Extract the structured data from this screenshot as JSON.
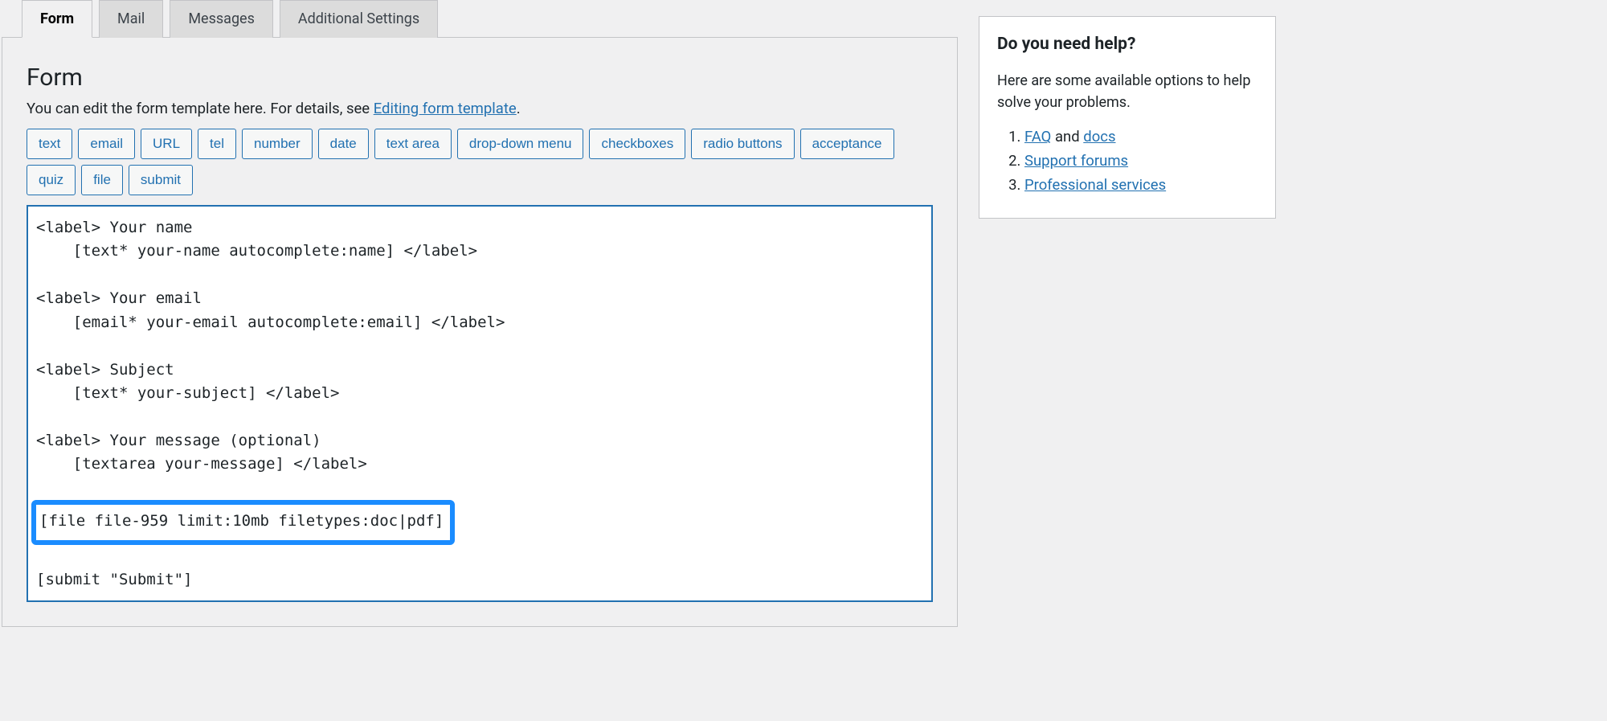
{
  "tabs": [
    {
      "label": "Form",
      "active": true
    },
    {
      "label": "Mail",
      "active": false
    },
    {
      "label": "Messages",
      "active": false
    },
    {
      "label": "Additional Settings",
      "active": false
    }
  ],
  "panel": {
    "heading": "Form",
    "intro_before_link": "You can edit the form template here. For details, see ",
    "intro_link": "Editing form template",
    "intro_after_link": "."
  },
  "tag_buttons": [
    "text",
    "email",
    "URL",
    "tel",
    "number",
    "date",
    "text area",
    "drop-down menu",
    "checkboxes",
    "radio buttons",
    "acceptance",
    "quiz",
    "file",
    "submit"
  ],
  "form_code": {
    "line1": "<label> Your name",
    "line2": "    [text* your-name autocomplete:name] </label>",
    "line3": "",
    "line4": "<label> Your email",
    "line5": "    [email* your-email autocomplete:email] </label>",
    "line6": "",
    "line7": "<label> Subject",
    "line8": "    [text* your-subject] </label>",
    "line9": "",
    "line10": "<label> Your message (optional)",
    "line11": "    [textarea your-message] </label>",
    "line12": "",
    "highlighted": "[file file-959 limit:10mb filetypes:doc|pdf]",
    "line14": "",
    "line15": "[submit \"Submit\"]"
  },
  "help": {
    "title": "Do you need help?",
    "intro": "Here are some available options to help solve your problems.",
    "items": [
      {
        "before": "",
        "link": "FAQ",
        "after": " and ",
        "link2": "docs"
      },
      {
        "before": "",
        "link": "Support forums",
        "after": ""
      },
      {
        "before": "",
        "link": "Professional services",
        "after": ""
      }
    ]
  }
}
